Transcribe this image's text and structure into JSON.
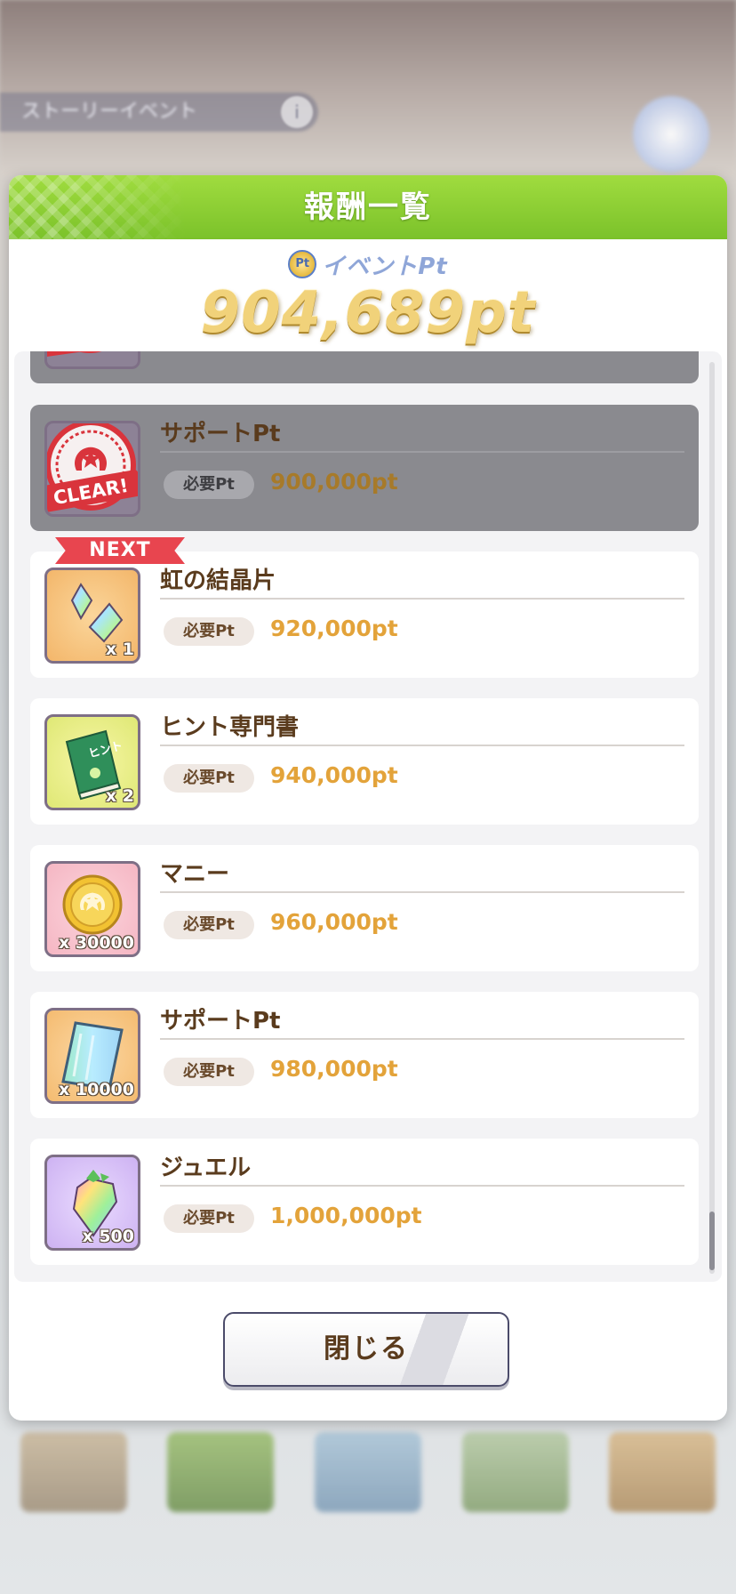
{
  "background": {
    "banner_label": "ストーリーイベント",
    "info_glyph": "i"
  },
  "modal": {
    "title": "報酬一覧",
    "event_pt_coin": "Pt",
    "event_pt_label": "イベントPt",
    "event_pt_value": "904,689pt"
  },
  "rewards": {
    "required_label": "必要Pt",
    "next_label": "NEXT",
    "clear_label": "CLEAR!",
    "items": [
      {
        "name": "",
        "required": "",
        "status": "cleared"
      },
      {
        "name": "サポートPt",
        "required": "900,000pt",
        "status": "cleared",
        "icon": "clear-stamp-icon"
      },
      {
        "name": "虹の結晶片",
        "required": "920,000pt",
        "status": "next",
        "icon": "rainbow-crystal-icon",
        "qty": "x 1"
      },
      {
        "name": "ヒント専門書",
        "required": "940,000pt",
        "status": "locked",
        "icon": "hint-book-icon",
        "qty": "x 2",
        "book_text": "ヒント"
      },
      {
        "name": "マニー",
        "required": "960,000pt",
        "status": "locked",
        "icon": "money-coin-icon",
        "qty": "x 30000"
      },
      {
        "name": "サポートPt",
        "required": "980,000pt",
        "status": "locked",
        "icon": "support-pt-card-icon",
        "qty": "x 10000"
      },
      {
        "name": "ジュエル",
        "required": "1,000,000pt",
        "status": "locked",
        "icon": "jewel-icon",
        "qty": "x 500"
      }
    ]
  },
  "footer": {
    "close_label": "閉じる"
  },
  "colors": {
    "header_green": "#8ccf33",
    "title_brown": "#5a3b1d",
    "pt_orange": "#e3a33a",
    "next_red": "#e8454f",
    "cleared_gray": "#8a8a8f"
  }
}
